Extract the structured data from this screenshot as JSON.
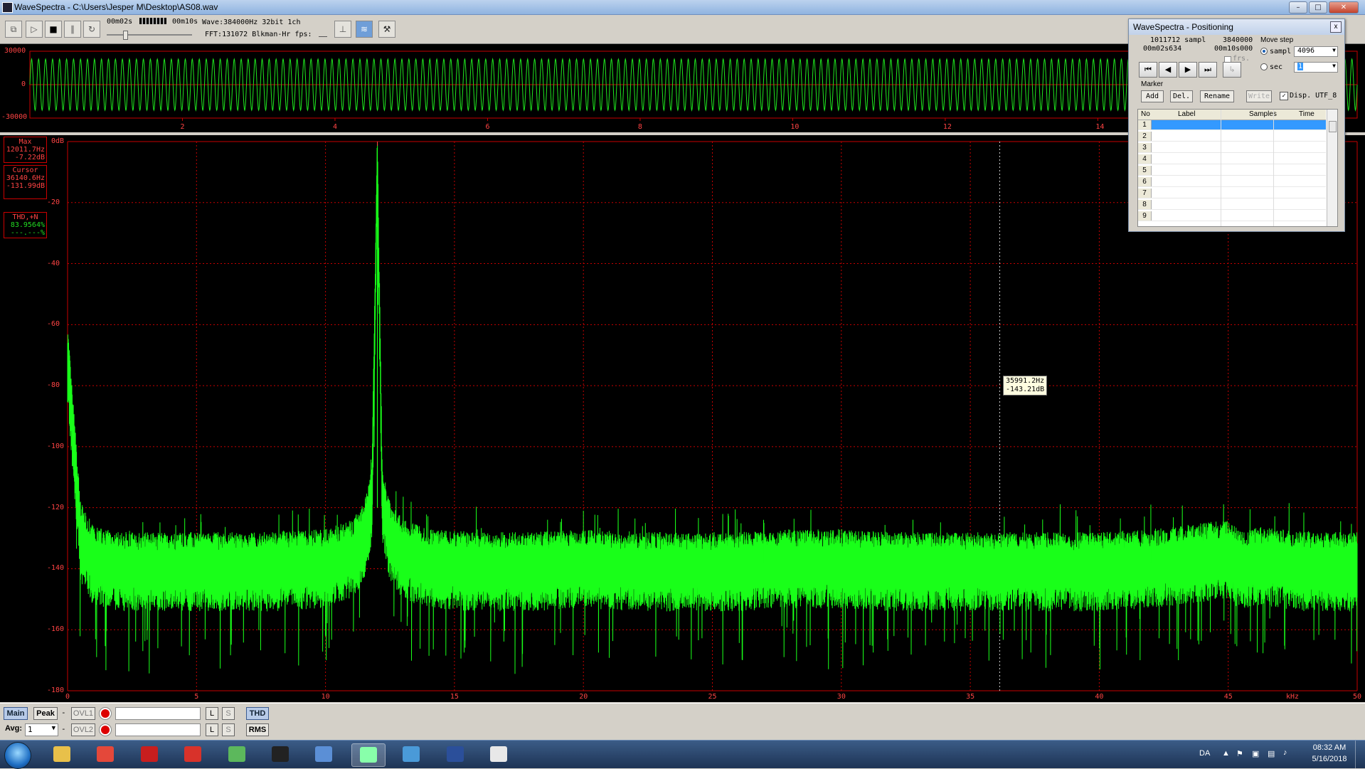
{
  "window": {
    "title": "WaveSpectra - C:\\Users\\Jesper M\\Desktop\\AS08.wav",
    "minimize_label": "–",
    "maximize_label": "□",
    "close_label": "✕"
  },
  "toolbar": {
    "time_start": "00m02s",
    "time_end": "00m10s",
    "wave_info": "Wave:384000Hz 32bit 1ch",
    "fft_info": "FFT:131072 Blkman-Hr fps:",
    "icons": [
      "copy-icon",
      "play-icon",
      "stop-icon",
      "pause-icon",
      "loop-icon",
      "fft-window-icon",
      "spectrum-view-icon",
      "settings-wrench-icon"
    ]
  },
  "waveform": {
    "y_labels": [
      "30000",
      "0",
      "-30000"
    ],
    "x_labels": [
      "2",
      "4",
      "6",
      "8",
      "10",
      "12",
      "14"
    ],
    "x_range": [
      0,
      17.4
    ],
    "y_range": [
      -30000,
      30000
    ],
    "color": "#1fe81f",
    "grid_color": "#c80000"
  },
  "spectrum": {
    "y_labels": [
      "0dB",
      "-20",
      "-40",
      "-60",
      "-80",
      "-100",
      "-120",
      "-140",
      "-160",
      "-180"
    ],
    "x_labels": [
      "0",
      "5",
      "10",
      "15",
      "20",
      "25",
      "30",
      "35",
      "40",
      "45",
      "50"
    ],
    "x_unit": "kHz",
    "x_range": [
      0,
      50
    ],
    "y_range": [
      -180,
      0
    ],
    "trace_color": "#19ff19",
    "grid_color": "#c80000"
  },
  "chart_data": {
    "type": "line",
    "title": "",
    "xlabel": "kHz",
    "ylabel": "",
    "xlim": [
      0,
      50
    ],
    "ylim": [
      -180,
      0
    ],
    "grid": true,
    "series": [
      {
        "x": [
          0,
          0.5,
          1,
          2,
          4,
          6,
          8,
          10,
          11,
          11.5,
          11.8,
          12.0117,
          12.2,
          12.5,
          13,
          14,
          16,
          18,
          20,
          22,
          24,
          26,
          28,
          30,
          32,
          34,
          36,
          38,
          40,
          42,
          44,
          45,
          45.5,
          46,
          48,
          50
        ],
        "y": [
          -72,
          -130,
          -138,
          -140,
          -140,
          -140,
          -140,
          -139,
          -136,
          -130,
          -118,
          -7.22,
          -118,
          -130,
          -136,
          -139,
          -140,
          -140,
          -139,
          -140,
          -140,
          -140,
          -139,
          -139,
          -140,
          -140,
          -140,
          -140,
          -140,
          -139,
          -137,
          -136,
          -140,
          -138,
          -140,
          -140
        ]
      }
    ],
    "peaks": [
      {
        "x": 20.0,
        "y": -121
      },
      {
        "x": 27.0,
        "y": -125
      },
      {
        "x": 42.0,
        "y": -119
      }
    ],
    "cursor_x": 36.1406
  },
  "readouts": {
    "max_label": "Max",
    "max_freq": "12011.7Hz",
    "max_db": "-7.22dB",
    "cursor_label": "Cursor",
    "cursor_freq": "36140.6Hz",
    "cursor_db": "-131.99dB",
    "thd_label": "THD,+N",
    "thd_value": "83.9564%",
    "thd_sub": "---.---%"
  },
  "tooltip": {
    "freq": "35991.2Hz",
    "db": "-143.21dB"
  },
  "statusbar": {
    "main_label": "Main",
    "peak_label": "Peak",
    "dash": "-",
    "ovl1_label": "OVL1",
    "ovl2_label": "OVL2",
    "l_label": "L",
    "s_label": "S",
    "thd_label": "THD",
    "rms_label": "RMS",
    "avg_label": "Avg:",
    "avg_value": "1"
  },
  "positioning": {
    "title": "WaveSpectra - Positioning",
    "close_label": "x",
    "current_samples": "1011712 sampl",
    "total_samples": "3840000",
    "current_time": "00m02s634",
    "total_time": "00m10s000",
    "move_step_label": "Move step",
    "sampl_option": "sampl",
    "sampl_value": "4096",
    "sec_option": "sec",
    "sec_value": "1",
    "frs_label": "frs.",
    "marker_label": "Marker",
    "add_label": "Add",
    "del_label": "Del.",
    "rename_label": "Rename",
    "write_label": "Write",
    "disp_label": "Disp. UTF_8",
    "columns": [
      "No",
      "Label",
      "Samples",
      "Time"
    ],
    "rows": [
      "1",
      "2",
      "3",
      "4",
      "5",
      "6",
      "7",
      "8",
      "9"
    ]
  },
  "taskbar": {
    "apps": [
      "explorer-icon",
      "chrome-icon",
      "acrobat-icon",
      "ccleaner-icon",
      "colors-app-icon",
      "terminal-icon",
      "image-viewer-icon",
      "wavespectra-icon",
      "network-monitor-icon",
      "pj-app-icon",
      "window-app-icon"
    ],
    "language": "DA",
    "time": "08:32 AM",
    "date": "5/16/2018"
  }
}
